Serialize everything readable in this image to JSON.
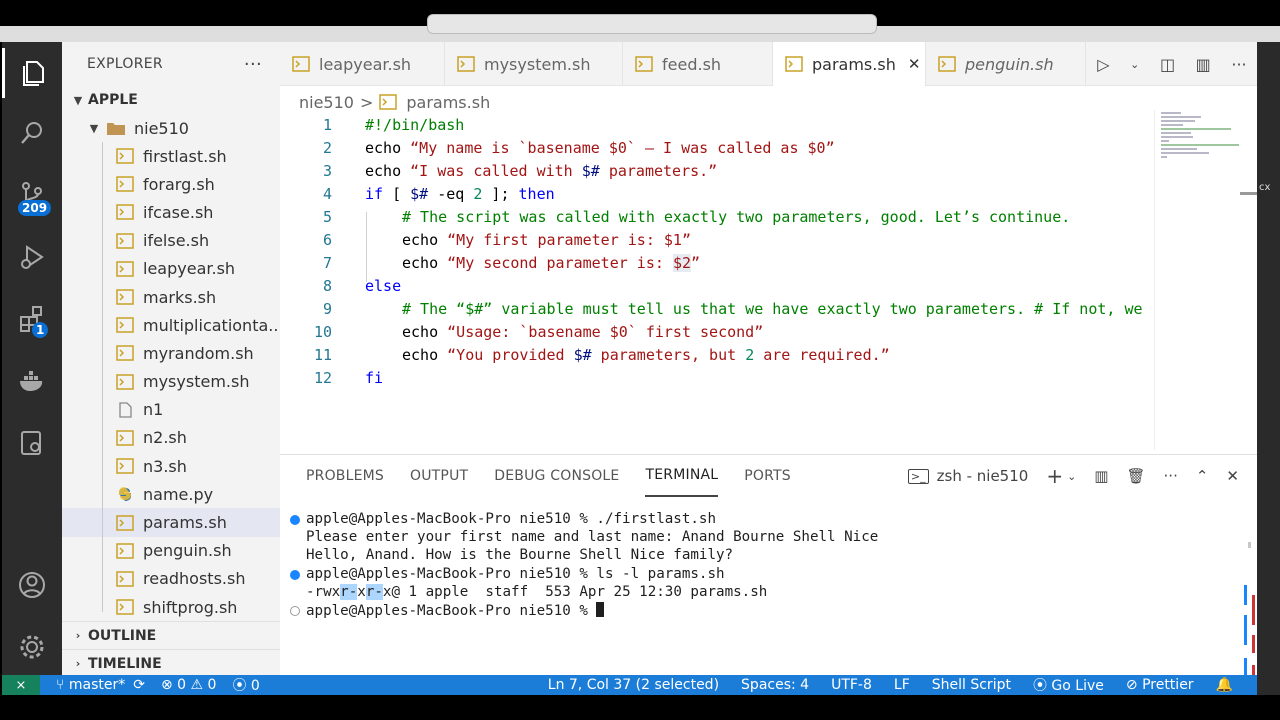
{
  "activity": {
    "scm_badge": "209",
    "extensions_badge": "1"
  },
  "sidebar": {
    "title": "EXPLORER",
    "more": "···",
    "root": "APPLE",
    "folder": "nie510",
    "files": [
      {
        "name": "firstlast.sh",
        "type": "sh"
      },
      {
        "name": "forarg.sh",
        "type": "sh"
      },
      {
        "name": "ifcase.sh",
        "type": "sh"
      },
      {
        "name": "ifelse.sh",
        "type": "sh"
      },
      {
        "name": "leapyear.sh",
        "type": "sh"
      },
      {
        "name": "marks.sh",
        "type": "sh"
      },
      {
        "name": "multiplicationta...",
        "type": "sh"
      },
      {
        "name": "myrandom.sh",
        "type": "sh"
      },
      {
        "name": "mysystem.sh",
        "type": "sh"
      },
      {
        "name": "n1",
        "type": "plain"
      },
      {
        "name": "n2.sh",
        "type": "sh"
      },
      {
        "name": "n3.sh",
        "type": "sh"
      },
      {
        "name": "name.py",
        "type": "py"
      },
      {
        "name": "params.sh",
        "type": "sh",
        "selected": true
      },
      {
        "name": "penguin.sh",
        "type": "sh"
      },
      {
        "name": "readhosts.sh",
        "type": "sh"
      },
      {
        "name": "shiftprog.sh",
        "type": "sh"
      }
    ],
    "outline": "OUTLINE",
    "timeline": "TIMELINE"
  },
  "tabs": [
    {
      "label": "leapyear.sh"
    },
    {
      "label": "mysystem.sh"
    },
    {
      "label": "feed.sh"
    },
    {
      "label": "params.sh",
      "active": true
    },
    {
      "label": "penguin.sh",
      "italic": true
    }
  ],
  "breadcrumb": {
    "folder": "nie510",
    "sep": ">",
    "file": "params.sh"
  },
  "editor": {
    "line_numbers": [
      "1",
      "2",
      "3",
      "4",
      "5",
      "6",
      "7",
      "8",
      "9",
      "10",
      "11",
      "12"
    ],
    "lines": {
      "l1": "#!/bin/bash",
      "l2_cmd": "echo ",
      "l2_str": "“My name is `basename $0` – I was called as $0”",
      "l3_cmd": "echo ",
      "l3_str_a": "“I was called with ",
      "l3_var": "$#",
      "l3_str_b": " parameters.”",
      "l4_if": "if",
      "l4_a": " [ ",
      "l4_var": "$#",
      "l4_b": " -eq ",
      "l4_num": "2",
      "l4_c": " ]; ",
      "l4_then": "then",
      "l5": "# The script was called with exactly two parameters, good. Let’s continue.",
      "l6_cmd": "echo ",
      "l6_str": "“My first parameter is: $1”",
      "l7_cmd": "echo ",
      "l7_str_a": "“My second parameter is: ",
      "l7_sel": "$2",
      "l7_str_b": "”",
      "l8": "else",
      "l9": "# The “$#” variable must tell us that we have exactly two parameters. # If not, we",
      "l10_cmd": "echo ",
      "l10_str": "“Usage: `basename $0` first second”",
      "l11_cmd": "echo ",
      "l11_str_a": "“You provided ",
      "l11_var": "$#",
      "l11_str_b": " parameters, but ",
      "l11_num": "2",
      "l11_str_c": " are required.”",
      "l12": "fi"
    }
  },
  "panel": {
    "tabs": [
      "PROBLEMS",
      "OUTPUT",
      "DEBUG CONSOLE",
      "TERMINAL",
      "PORTS"
    ],
    "active_tab": "TERMINAL",
    "terminal_name": "zsh - nie510",
    "terminal": {
      "t1": "apple@Apples-MacBook-Pro nie510 % ./firstlast.sh",
      "t2": "Please enter your first name and last name: Anand Bourne Shell Nice",
      "t3": "Hello, Anand. How is the Bourne Shell Nice family?",
      "t4": "apple@Apples-MacBook-Pro nie510 % ls -l params.sh",
      "t5_a": "-rwx",
      "t5_sel1": "r-",
      "t5_b": "x",
      "t5_sel2": "r-",
      "t5_c": "x@ 1 apple  staff  553 Apr 25 12:30 params.sh",
      "t6": "apple@Apples-MacBook-Pro nie510 % "
    }
  },
  "status": {
    "branch": "master*",
    "errors": "0",
    "warnings": "0",
    "ports": "0",
    "position": "Ln 7, Col 37 (2 selected)",
    "spaces": "Spaces: 4",
    "encoding": "UTF-8",
    "eol": "LF",
    "language": "Shell Script",
    "golive": "Go Live",
    "prettier": "Prettier"
  },
  "colors": {
    "activity_bar": "#2c2c2c",
    "status_bar": "#1c7dd8",
    "remote": "#16825d",
    "keyword": "#0000ff",
    "string": "#a31515",
    "comment": "#008000"
  }
}
